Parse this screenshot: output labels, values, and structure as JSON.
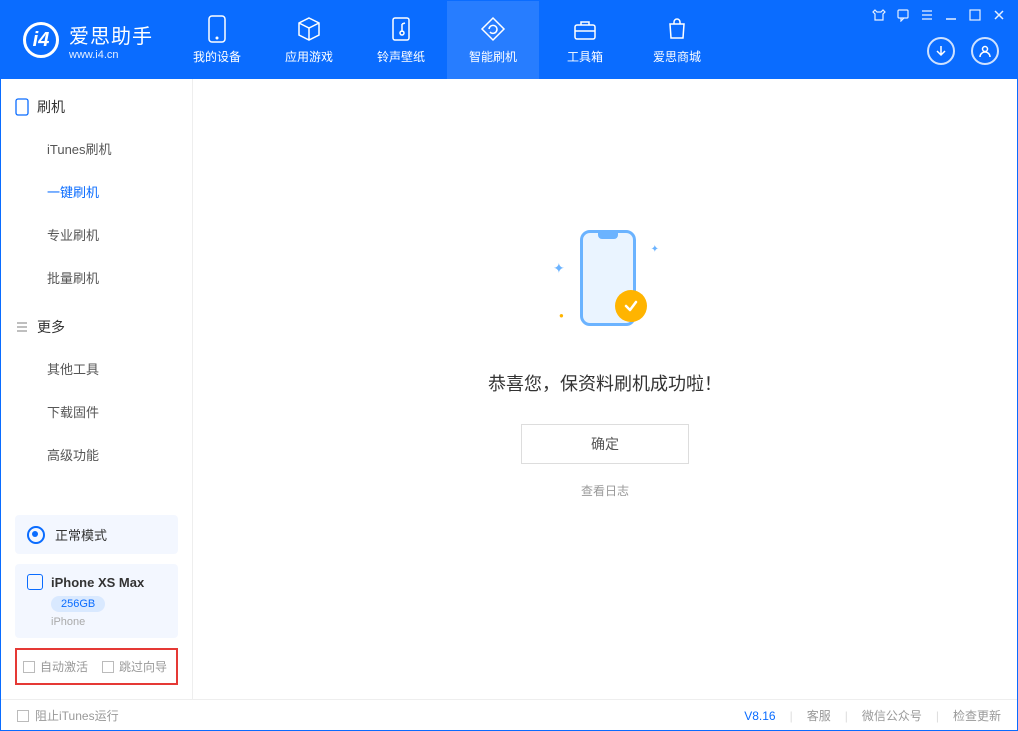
{
  "app": {
    "title": "爱思助手",
    "subtitle": "www.i4.cn"
  },
  "nav": {
    "items": [
      {
        "label": "我的设备",
        "icon": "device-icon"
      },
      {
        "label": "应用游戏",
        "icon": "cube-icon"
      },
      {
        "label": "铃声壁纸",
        "icon": "music-icon"
      },
      {
        "label": "智能刷机",
        "icon": "refresh-icon"
      },
      {
        "label": "工具箱",
        "icon": "toolbox-icon"
      },
      {
        "label": "爱思商城",
        "icon": "shop-icon"
      }
    ]
  },
  "sidebar": {
    "section1_title": "刷机",
    "section1_items": [
      "iTunes刷机",
      "一键刷机",
      "专业刷机",
      "批量刷机"
    ],
    "section2_title": "更多",
    "section2_items": [
      "其他工具",
      "下载固件",
      "高级功能"
    ]
  },
  "mode": {
    "label": "正常模式"
  },
  "device": {
    "name": "iPhone XS Max",
    "storage": "256GB",
    "type": "iPhone"
  },
  "checkboxes": {
    "auto_activate": "自动激活",
    "skip_guide": "跳过向导"
  },
  "main": {
    "success_message": "恭喜您，保资料刷机成功啦！",
    "confirm_label": "确定",
    "log_link": "查看日志"
  },
  "footer": {
    "block_itunes": "阻止iTunes运行",
    "version": "V8.16",
    "support": "客服",
    "wechat": "微信公众号",
    "update": "检查更新"
  }
}
